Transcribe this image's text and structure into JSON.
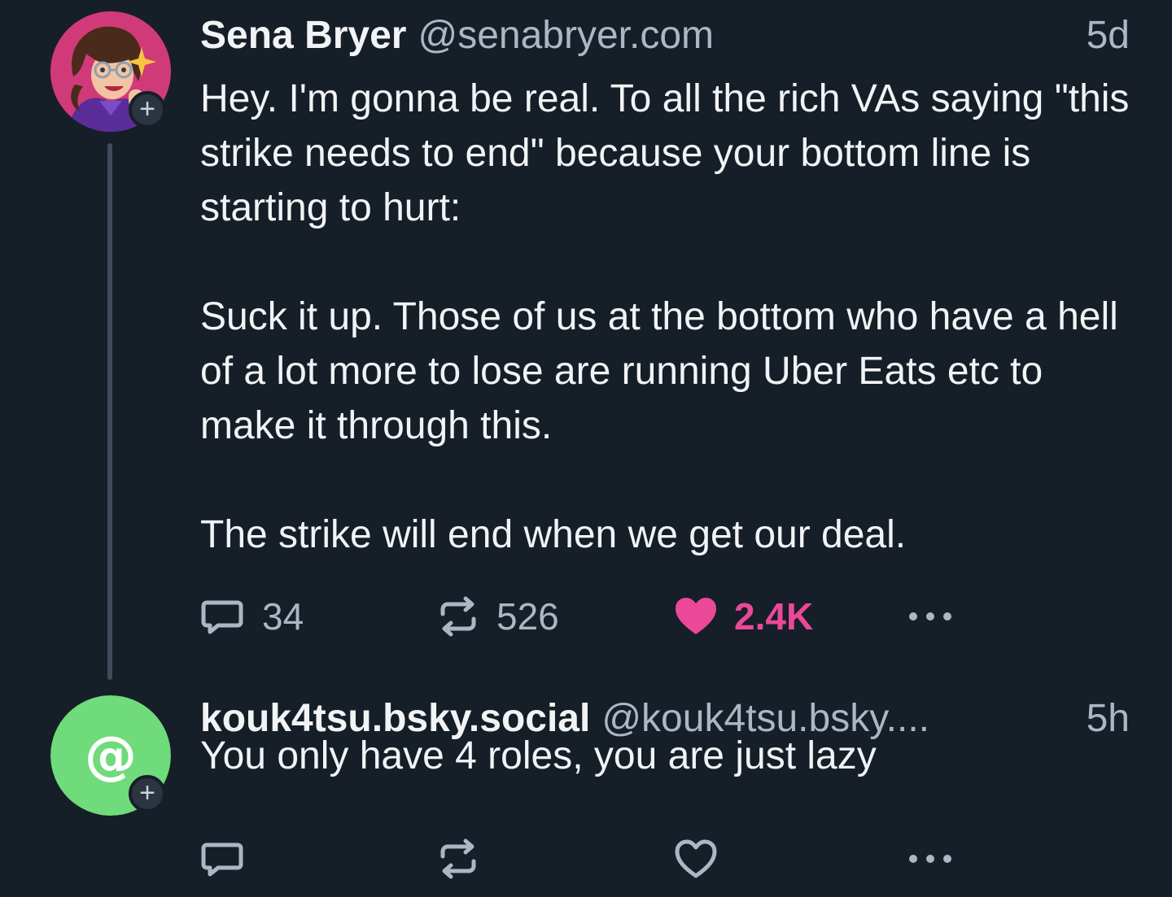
{
  "posts": [
    {
      "author_name": "Sena Bryer",
      "handle": "@senabryer.com",
      "time": "5d",
      "paragraphs": [
        "Hey. I'm gonna be real. To all the rich VAs saying \"this strike needs to end\" because your bottom line is starting to hurt:",
        "Suck it up. Those of us at the bottom who have a hell of a lot more to lose are running Uber Eats etc to make it through this.",
        "The strike will end when we get our deal."
      ],
      "replies": "34",
      "reposts": "526",
      "likes": "2.4K",
      "liked": true,
      "avatar": "cartoon-woman-glasses-avatar"
    },
    {
      "author_name": "kouk4tsu.bsky.social",
      "handle": "@kouk4tsu.bsky....",
      "time": "5h",
      "text": "You only have 4 roles, you are just lazy",
      "liked": false,
      "avatar": "default-at-sign-avatar"
    }
  ],
  "colors": {
    "background": "#161e27",
    "muted": "#aab7c4",
    "like_pink": "#ec4899",
    "default_avatar_green": "#6fdb7b"
  },
  "icons": {
    "follow": "+",
    "at": "@"
  }
}
